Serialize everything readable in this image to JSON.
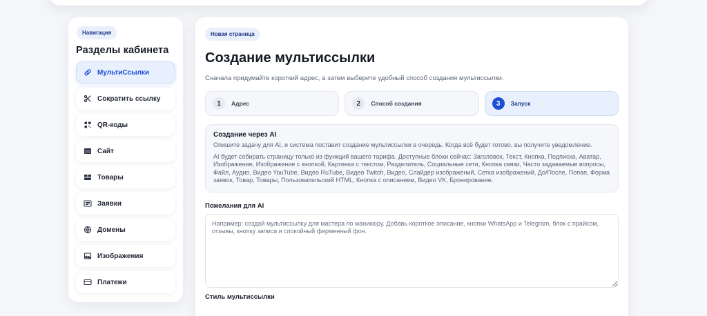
{
  "sidebar": {
    "badge": "Навигация",
    "title": "Разделы кабинета",
    "items": [
      {
        "label": "МультиСсылки",
        "icon": "link-icon",
        "active": true
      },
      {
        "label": "Сократить ссылку",
        "icon": "scissors-icon",
        "active": false
      },
      {
        "label": "QR-коды",
        "icon": "qr-code-icon",
        "active": false
      },
      {
        "label": "Сайт",
        "icon": "window-icon",
        "active": false
      },
      {
        "label": "Товары",
        "icon": "boxes-icon",
        "active": false
      },
      {
        "label": "Заявки",
        "icon": "list-icon",
        "active": false
      },
      {
        "label": "Домены",
        "icon": "globe-icon",
        "active": false
      },
      {
        "label": "Изображения",
        "icon": "image-icon",
        "active": false
      },
      {
        "label": "Платежи",
        "icon": "credit-card-icon",
        "active": false
      }
    ]
  },
  "main": {
    "badge": "Новая страница",
    "title": "Создание мультиссылки",
    "subtitle": "Сначала придумайте короткий адрес, а затем выберите удобный способ создания мультиссылки.",
    "steps": [
      {
        "num": "1",
        "label": "Адрес",
        "active": false
      },
      {
        "num": "2",
        "label": "Способ создания",
        "active": false
      },
      {
        "num": "3",
        "label": "Запуск",
        "active": true
      }
    ],
    "ai_box": {
      "title": "Создание через AI",
      "text1": "Опишите задачу для AI, и система поставит создание мультиссылки в очередь. Когда всё будет готово, вы получите уведомление.",
      "text2": "AI будет собирать страницу только из функций вашего тарифа. Доступные блоки сейчас: Заголовок, Текст, Кнопка, Подписка, Аватар, Изображение, Изображение с кнопкой, Картинка с текстом, Разделитель, Социальные сети, Кнопка связи, Часто задаваемые вопросы, Файл, Аудио, Видео YouTube, Видео RuTube, Видео Twitch, Видео, Слайдер изображений, Сетка изображений, До/После, Попап, Форма заявок, Товар, Товары, Пользовательский HTML, Кнопка с описанием, Видео VK, Бронирование."
    },
    "wishes": {
      "label": "Пожелания для AI",
      "placeholder": "Например: создай мультиссылку для мастера по маникюру. Добавь короткое описание, кнопки WhatsApp и Telegram, блок с прайсом, отзывы, кнопку записи и спокойный фирменный фон.",
      "value": ""
    },
    "style_label": "Стиль мультиссылки"
  }
}
